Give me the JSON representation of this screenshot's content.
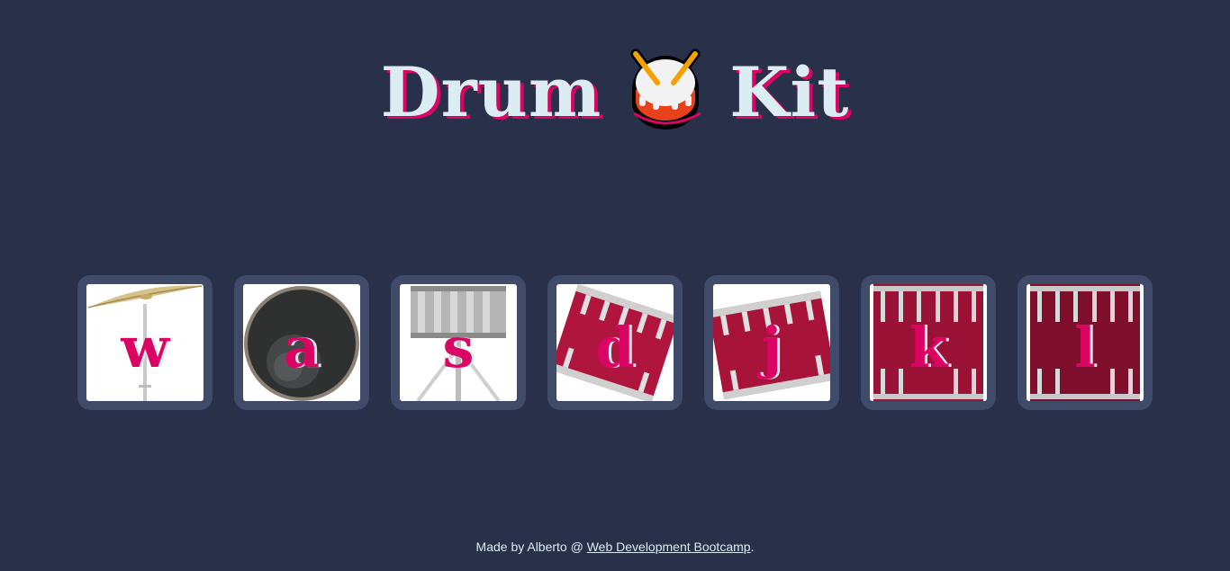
{
  "header": {
    "title_word_1": "Drum",
    "title_word_2": "Kit",
    "title_icon": "drum-emoji-icon"
  },
  "drums": [
    {
      "key": "w",
      "instrument_icon": "crash-cymbal-icon"
    },
    {
      "key": "a",
      "instrument_icon": "kick-drum-icon"
    },
    {
      "key": "s",
      "instrument_icon": "snare-drum-icon"
    },
    {
      "key": "d",
      "instrument_icon": "tom-1-icon"
    },
    {
      "key": "j",
      "instrument_icon": "tom-2-icon"
    },
    {
      "key": "k",
      "instrument_icon": "tom-3-icon"
    },
    {
      "key": "l",
      "instrument_icon": "tom-4-icon"
    }
  ],
  "footer": {
    "prefix": "Made by Alberto @ ",
    "link_text": "Web Development Bootcamp",
    "suffix": "."
  },
  "colors": {
    "background": "#283149",
    "button_frame": "#404b69",
    "accent_pink": "#da0463",
    "light_text": "#dbedf3"
  }
}
